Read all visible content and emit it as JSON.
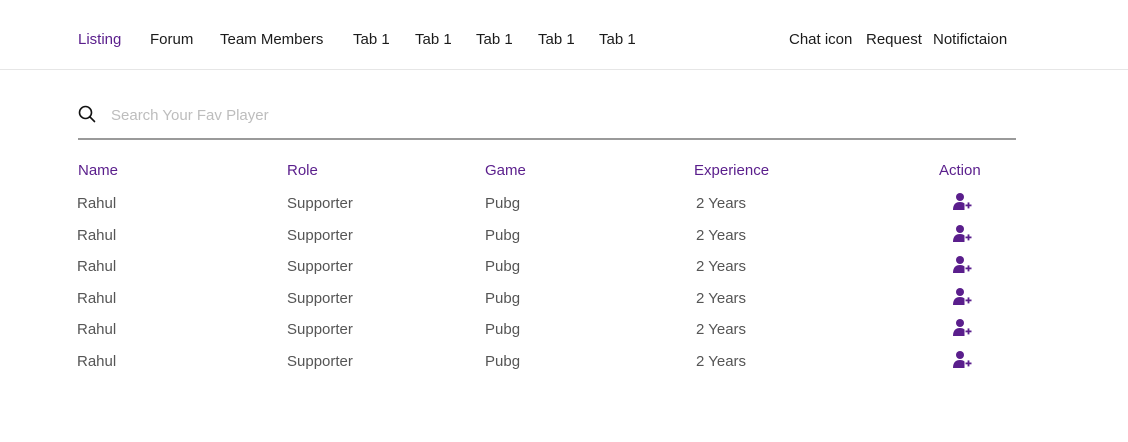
{
  "nav": {
    "tabs": [
      {
        "label": "Listing",
        "active": true
      },
      {
        "label": "Forum"
      },
      {
        "label": "Team Members"
      },
      {
        "label": "Tab 1"
      },
      {
        "label": "Tab 1"
      },
      {
        "label": "Tab 1"
      },
      {
        "label": "Tab 1"
      },
      {
        "label": "Tab 1"
      }
    ],
    "right": {
      "chat": "Chat icon",
      "request": "Request",
      "notification": "Notifictaion"
    }
  },
  "search": {
    "placeholder": "Search Your Fav Player",
    "value": "",
    "icon": "search-icon"
  },
  "table": {
    "headers": {
      "name": "Name",
      "role": "Role",
      "game": "Game",
      "experience": "Experience",
      "action": "Action"
    },
    "rows": [
      {
        "name": "Rahul",
        "role": "Supporter",
        "game": "Pubg",
        "experience": "2 Years",
        "action_icon": "add-user-icon"
      },
      {
        "name": "Rahul",
        "role": "Supporter",
        "game": "Pubg",
        "experience": "2 Years",
        "action_icon": "add-user-icon"
      },
      {
        "name": "Rahul",
        "role": "Supporter",
        "game": "Pubg",
        "experience": "2 Years",
        "action_icon": "add-user-icon"
      },
      {
        "name": "Rahul",
        "role": "Supporter",
        "game": "Pubg",
        "experience": "2 Years",
        "action_icon": "add-user-icon"
      },
      {
        "name": "Rahul",
        "role": "Supporter",
        "game": "Pubg",
        "experience": "2 Years",
        "action_icon": "add-user-icon"
      },
      {
        "name": "Rahul",
        "role": "Supporter",
        "game": "Pubg",
        "experience": "2 Years",
        "action_icon": "add-user-icon"
      }
    ]
  },
  "colors": {
    "accent": "#5a1e8c",
    "text": "#1b1b1b",
    "muted_text": "#555555",
    "placeholder": "#bdbdbd",
    "divider": "#e6e6e6"
  }
}
